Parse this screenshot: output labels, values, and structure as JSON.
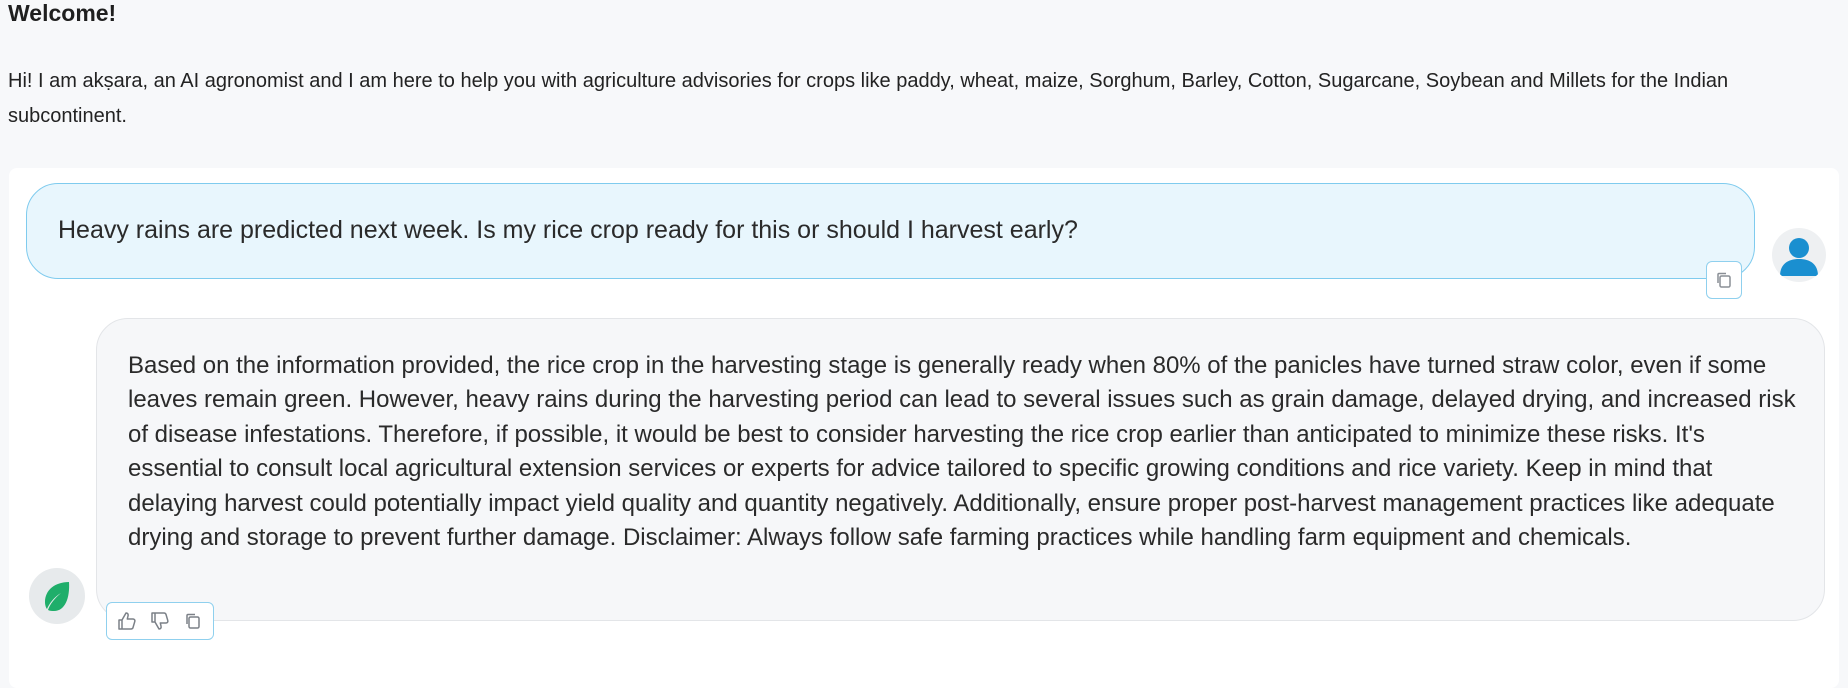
{
  "intro": {
    "title": "Welcome!",
    "text": "Hi! I am akṣara, an AI agronomist and I am here to help you with agriculture advisories for crops like paddy, wheat, maize, Sorghum, Barley, Cotton, Sugarcane, Soybean and Millets for the Indian subcontinent."
  },
  "conversation": {
    "user_message": "Heavy rains are predicted next week. Is my rice crop ready for this or should I harvest early?",
    "bot_message": "Based on the information provided, the rice crop in the harvesting stage is generally ready when 80% of the panicles have turned straw color, even if some leaves remain green. However, heavy rains during the harvesting period can lead to several issues such as grain damage, delayed drying, and increased risk of disease infestations. Therefore, if possible, it would be best to consider harvesting the rice crop earlier than anticipated to minimize these risks. It's essential to consult local agricultural extension services or experts for advice tailored to specific growing conditions and rice variety. Keep in mind that delaying harvest could potentially impact yield quality and quantity negatively. Additionally, ensure proper post-harvest management practices like adequate drying and storage to prevent further damage. Disclaimer: Always follow safe farming practices while handling farm equipment and chemicals."
  },
  "icons": {
    "user_avatar": "user-avatar-icon",
    "bot_avatar": "leaf-icon",
    "copy": "copy-icon",
    "like": "thumbs-up-icon",
    "dislike": "thumbs-down-icon"
  },
  "colors": {
    "user_bubble_bg": "#e8f6fd",
    "user_bubble_border": "#7fcbee",
    "user_avatar": "#1a8fd0",
    "bot_leaf": "#1fae6a",
    "action_border": "#8fd0ee"
  }
}
